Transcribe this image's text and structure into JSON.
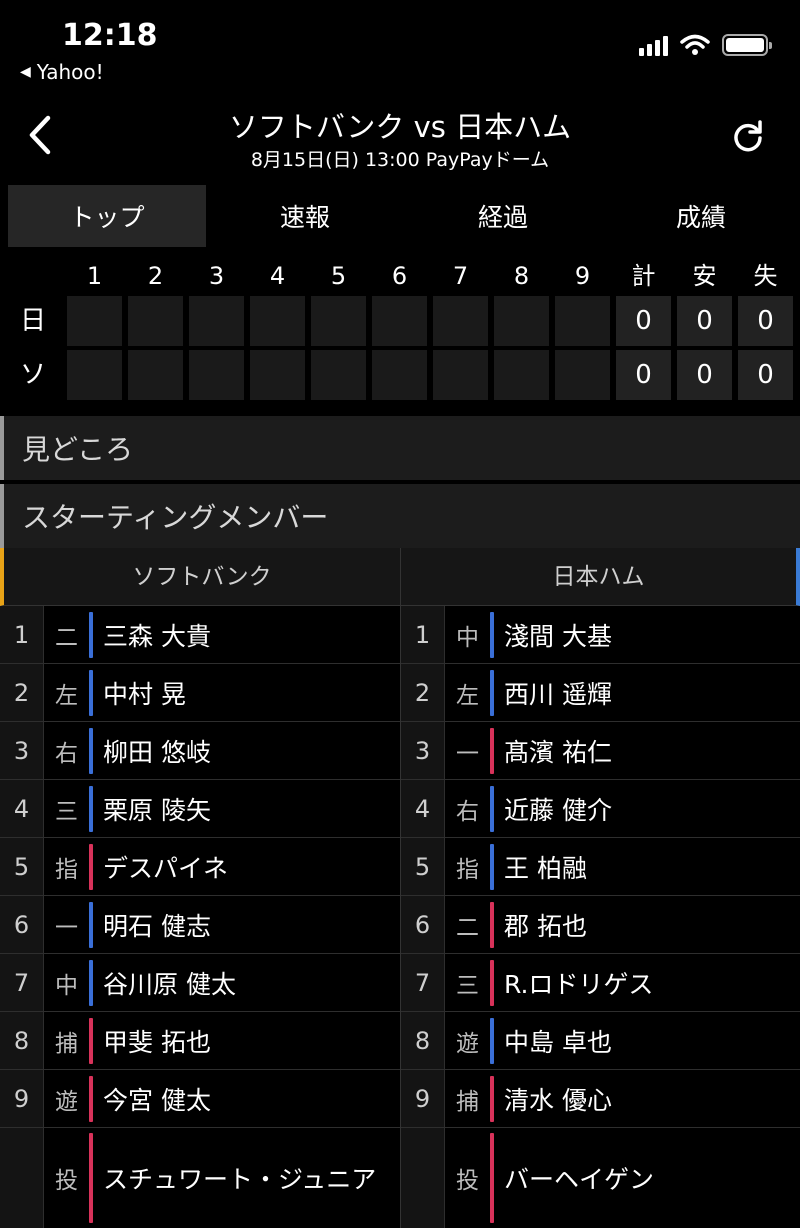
{
  "status_bar": {
    "time": "12:18",
    "back_app": "Yahoo!"
  },
  "header": {
    "title": "ソフトバンク vs 日本ハム",
    "subtitle": "8月15日(日) 13:00 PayPayドーム"
  },
  "tabs": [
    {
      "label": "トップ",
      "active": true
    },
    {
      "label": "速報",
      "active": false
    },
    {
      "label": "経過",
      "active": false
    },
    {
      "label": "成績",
      "active": false
    }
  ],
  "scoreboard": {
    "headers": [
      "1",
      "2",
      "3",
      "4",
      "5",
      "6",
      "7",
      "8",
      "9",
      "計",
      "安",
      "失"
    ],
    "rows": [
      {
        "team": "日",
        "innings": [
          "",
          "",
          "",
          "",
          "",
          "",
          "",
          "",
          ""
        ],
        "totals": [
          "0",
          "0",
          "0"
        ]
      },
      {
        "team": "ソ",
        "innings": [
          "",
          "",
          "",
          "",
          "",
          "",
          "",
          "",
          ""
        ],
        "totals": [
          "0",
          "0",
          "0"
        ]
      }
    ]
  },
  "sections": {
    "highlights": "見どころ",
    "starting": "スターティングメンバー"
  },
  "colors": {
    "home_accent": "#e8a317",
    "away_accent": "#3a7bd5",
    "right_handed": "#3a6fd8",
    "left_handed": "#d8325a"
  },
  "lineups": {
    "home": {
      "team": "ソフトバンク",
      "players": [
        {
          "order": "1",
          "pos": "二",
          "name": "三森 大貴",
          "hand": "blue"
        },
        {
          "order": "2",
          "pos": "左",
          "name": "中村 晃",
          "hand": "blue"
        },
        {
          "order": "3",
          "pos": "右",
          "name": "柳田 悠岐",
          "hand": "blue"
        },
        {
          "order": "4",
          "pos": "三",
          "name": "栗原 陵矢",
          "hand": "blue"
        },
        {
          "order": "5",
          "pos": "指",
          "name": "デスパイネ",
          "hand": "red"
        },
        {
          "order": "6",
          "pos": "一",
          "name": "明石 健志",
          "hand": "blue"
        },
        {
          "order": "7",
          "pos": "中",
          "name": "谷川原 健太",
          "hand": "blue"
        },
        {
          "order": "8",
          "pos": "捕",
          "name": "甲斐 拓也",
          "hand": "red"
        },
        {
          "order": "9",
          "pos": "遊",
          "name": "今宮 健太",
          "hand": "red"
        }
      ],
      "pitcher": {
        "pos": "投",
        "name": "スチュワート・ジュニア",
        "hand": "red"
      }
    },
    "away": {
      "team": "日本ハム",
      "players": [
        {
          "order": "1",
          "pos": "中",
          "name": "淺間 大基",
          "hand": "blue"
        },
        {
          "order": "2",
          "pos": "左",
          "name": "西川 遥輝",
          "hand": "blue"
        },
        {
          "order": "3",
          "pos": "一",
          "name": "髙濱 祐仁",
          "hand": "red"
        },
        {
          "order": "4",
          "pos": "右",
          "name": "近藤 健介",
          "hand": "blue"
        },
        {
          "order": "5",
          "pos": "指",
          "name": "王 柏融",
          "hand": "blue"
        },
        {
          "order": "6",
          "pos": "二",
          "name": "郡 拓也",
          "hand": "red"
        },
        {
          "order": "7",
          "pos": "三",
          "name": "R.ロドリゲス",
          "hand": "red"
        },
        {
          "order": "8",
          "pos": "遊",
          "name": "中島 卓也",
          "hand": "blue"
        },
        {
          "order": "9",
          "pos": "捕",
          "name": "清水 優心",
          "hand": "red"
        }
      ],
      "pitcher": {
        "pos": "投",
        "name": "バーヘイゲン",
        "hand": "red"
      }
    }
  }
}
